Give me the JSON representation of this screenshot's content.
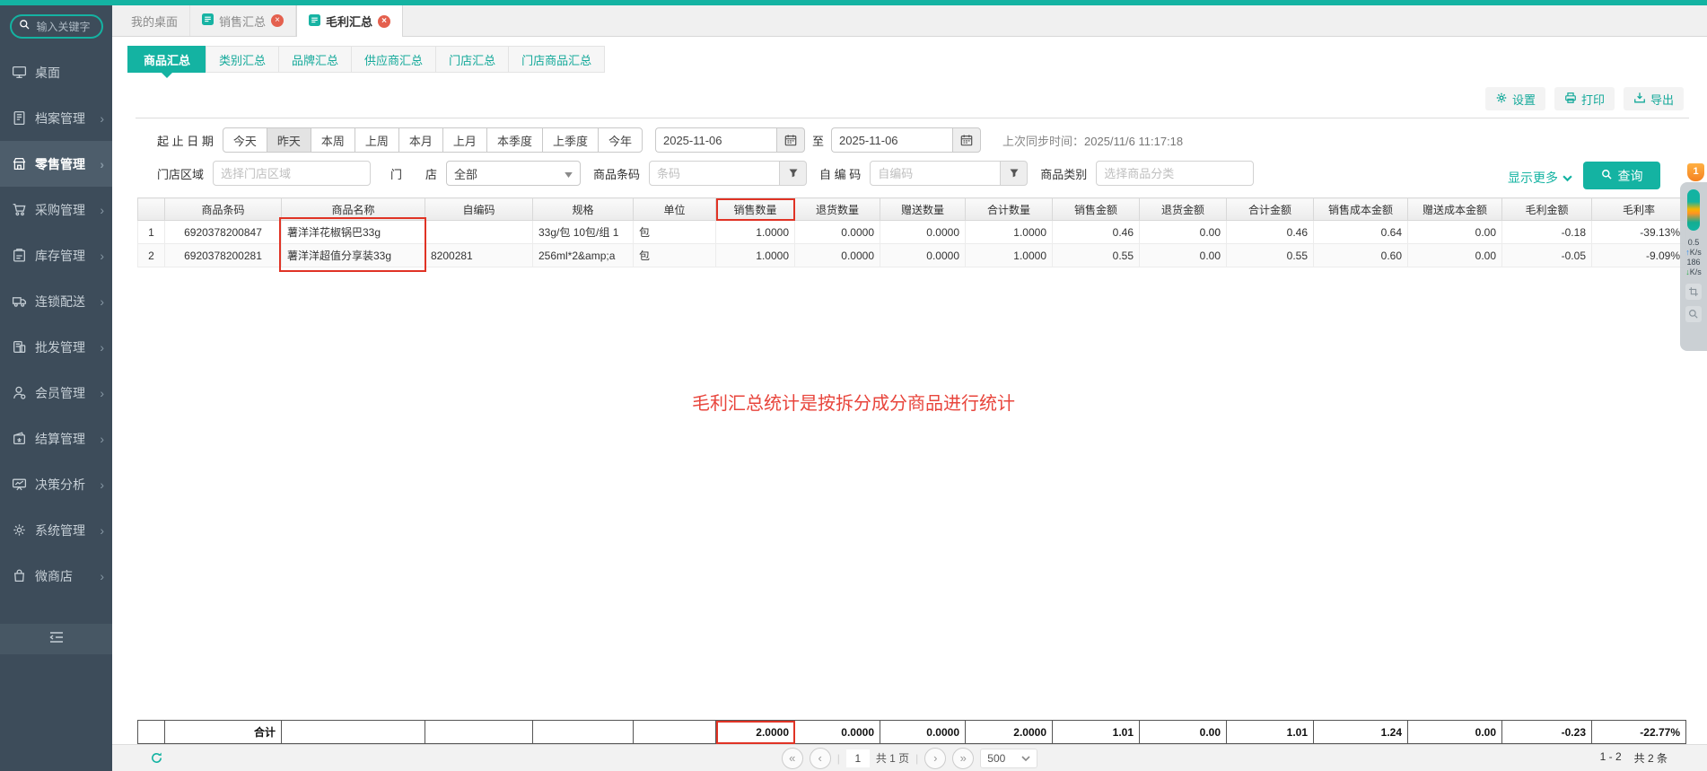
{
  "colors": {
    "teal": "#14b3a2",
    "sidebar_bg": "#3d4c5a",
    "annotation_red": "#e03325"
  },
  "sidebar": {
    "search_placeholder": "输入关键字",
    "items": [
      {
        "key": "desktop",
        "label": "桌面",
        "icon": "desktop-icon",
        "active": false,
        "expandable": false
      },
      {
        "key": "archives",
        "label": "档案管理",
        "icon": "archive-icon",
        "active": false,
        "expandable": true
      },
      {
        "key": "retail",
        "label": "零售管理",
        "icon": "store-icon",
        "active": true,
        "expandable": true
      },
      {
        "key": "purchase",
        "label": "采购管理",
        "icon": "cart-icon",
        "active": false,
        "expandable": true
      },
      {
        "key": "inventory",
        "label": "库存管理",
        "icon": "clipboard-icon",
        "active": false,
        "expandable": true
      },
      {
        "key": "chain-delivery",
        "label": "连锁配送",
        "icon": "truck-icon",
        "active": false,
        "expandable": true
      },
      {
        "key": "wholesale",
        "label": "批发管理",
        "icon": "invoice-icon",
        "active": false,
        "expandable": true
      },
      {
        "key": "member",
        "label": "会员管理",
        "icon": "person-icon",
        "active": false,
        "expandable": true
      },
      {
        "key": "settlement",
        "label": "结算管理",
        "icon": "wallet-icon",
        "active": false,
        "expandable": true
      },
      {
        "key": "decision-analysis",
        "label": "决策分析",
        "icon": "chart-board-icon",
        "active": false,
        "expandable": true
      },
      {
        "key": "system",
        "label": "系统管理",
        "icon": "gear-icon",
        "active": false,
        "expandable": true
      },
      {
        "key": "micro-store",
        "label": "微商店",
        "icon": "bag-icon",
        "active": false,
        "expandable": true
      }
    ]
  },
  "tabs": [
    {
      "key": "my-desktop",
      "label": "我的桌面",
      "active": false,
      "closable": false,
      "doc_icon": false
    },
    {
      "key": "sales-summary",
      "label": "销售汇总",
      "active": false,
      "closable": true,
      "doc_icon": true
    },
    {
      "key": "gross-profit-summary",
      "label": "毛利汇总",
      "active": true,
      "closable": true,
      "doc_icon": true
    }
  ],
  "subtabs": [
    {
      "key": "product-summary",
      "label": "商品汇总",
      "active": true
    },
    {
      "key": "category-summary",
      "label": "类别汇总",
      "active": false
    },
    {
      "key": "brand-summary",
      "label": "品牌汇总",
      "active": false
    },
    {
      "key": "supplier-summary",
      "label": "供应商汇总",
      "active": false
    },
    {
      "key": "store-summary",
      "label": "门店汇总",
      "active": false
    },
    {
      "key": "store-product-summary",
      "label": "门店商品汇总",
      "active": false
    }
  ],
  "toolbar": {
    "settings": "设置",
    "print": "打印",
    "export": "导出"
  },
  "filters": {
    "date_label": "起 止 日 期",
    "presets": [
      {
        "key": "today",
        "label": "今天"
      },
      {
        "key": "yesterday",
        "label": "昨天"
      },
      {
        "key": "this-week",
        "label": "本周"
      },
      {
        "key": "last-week",
        "label": "上周"
      },
      {
        "key": "this-month",
        "label": "本月"
      },
      {
        "key": "last-month",
        "label": "上月"
      },
      {
        "key": "this-quarter",
        "label": "本季度"
      },
      {
        "key": "last-quarter",
        "label": "上季度"
      },
      {
        "key": "this-year",
        "label": "今年"
      }
    ],
    "active_preset": "昨天",
    "date_from": "2025-11-06",
    "to_label": "至",
    "date_to": "2025-11-06",
    "sync_label": "上次同步时间：",
    "sync_time": "2025/11/6 11:17:18",
    "show_more": "显示更多",
    "query": "查询",
    "region_label": "门店区域",
    "region_placeholder": "选择门店区域",
    "store_label": "门　　店",
    "store_value": "全部",
    "barcode_label": "商品条码",
    "barcode_placeholder": "条码",
    "code_label": "自 编 码",
    "code_placeholder": "自编码",
    "category_label": "商品类别",
    "category_placeholder": "选择商品分类"
  },
  "table": {
    "columns": [
      {
        "key": "row-no",
        "label": ""
      },
      {
        "key": "barcode",
        "label": "商品条码"
      },
      {
        "key": "product-name",
        "label": "商品名称"
      },
      {
        "key": "custom-code",
        "label": "自编码"
      },
      {
        "key": "spec",
        "label": "规格"
      },
      {
        "key": "unit",
        "label": "单位"
      },
      {
        "key": "sales-qty",
        "label": "销售数量"
      },
      {
        "key": "return-qty",
        "label": "退货数量"
      },
      {
        "key": "gift-qty",
        "label": "赠送数量"
      },
      {
        "key": "total-qty",
        "label": "合计数量"
      },
      {
        "key": "sales-amount",
        "label": "销售金额"
      },
      {
        "key": "return-amount",
        "label": "退货金额"
      },
      {
        "key": "total-amount",
        "label": "合计金额"
      },
      {
        "key": "sales-cost",
        "label": "销售成本金额"
      },
      {
        "key": "gift-cost",
        "label": "赠送成本金额"
      },
      {
        "key": "gross-profit",
        "label": "毛利金额"
      },
      {
        "key": "gross-margin",
        "label": "毛利率"
      }
    ],
    "rows": [
      [
        "1",
        "6920378200847",
        "薯洋洋花椒锅巴33g",
        "",
        "33g/包 10包/组 1",
        "包",
        "1.0000",
        "0.0000",
        "0.0000",
        "1.0000",
        "0.46",
        "0.00",
        "0.46",
        "0.64",
        "0.00",
        "-0.18",
        "-39.13%"
      ],
      [
        "2",
        "6920378200281",
        "薯洋洋超值分享装33g",
        "8200281",
        "256ml*2&amp;a",
        "包",
        "1.0000",
        "0.0000",
        "0.0000",
        "1.0000",
        "0.55",
        "0.00",
        "0.55",
        "0.60",
        "0.00",
        "-0.05",
        "-9.09%"
      ]
    ],
    "totals": [
      "",
      "合计",
      "",
      "",
      "",
      "",
      "2.0000",
      "0.0000",
      "0.0000",
      "2.0000",
      "1.01",
      "0.00",
      "1.01",
      "1.24",
      "0.00",
      "-0.23",
      "-22.77%"
    ]
  },
  "annotations": {
    "note": "毛利汇总统计是按拆分成分商品进行统计",
    "boxed_header": "销售数量",
    "boxed_total_column": "销售数量",
    "boxed_name_rows": true
  },
  "pagination": {
    "page": "1",
    "total_pages_label": "共 1 页",
    "page_size": "500",
    "range_label": "1 - 2",
    "total_label": "共 2 条"
  },
  "overlay_widget": {
    "badge": "1",
    "up_value": "0.5",
    "up_unit": "K/s",
    "down_value": "186",
    "down_unit": "K/s"
  }
}
